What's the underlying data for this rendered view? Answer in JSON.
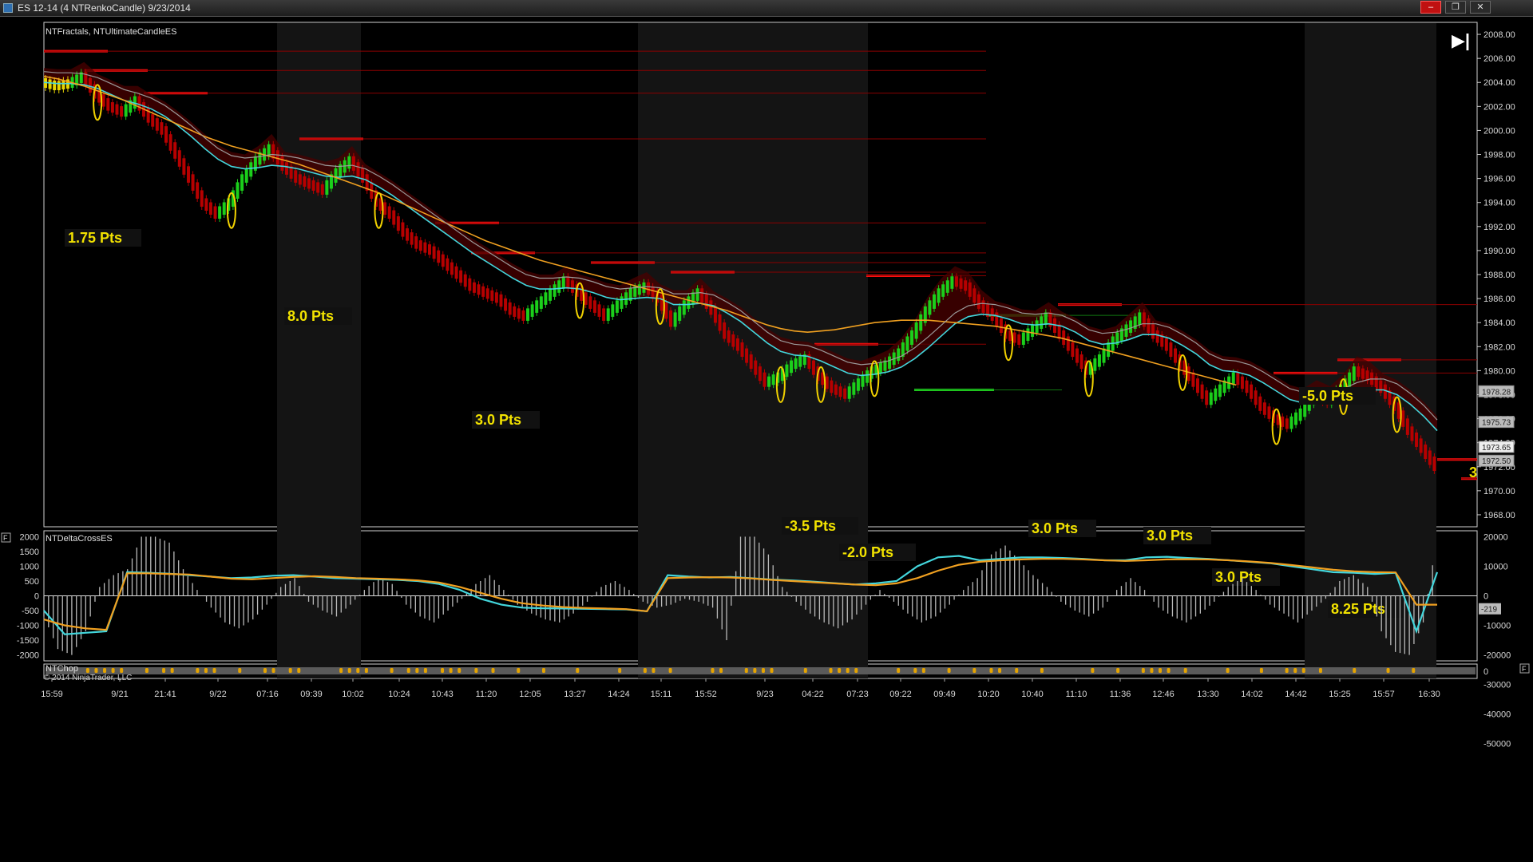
{
  "window": {
    "title": "ES 12-14 (4 NTRenkoCandle)  9/23/2014",
    "minimize_label": "–",
    "restore_label": "❐",
    "close_label": "✕"
  },
  "price_panel": {
    "indicator_label": "NTFractals, NTUltimateCandleES",
    "play_icon_label": "▶|",
    "partial_label": "3"
  },
  "delta_panel": {
    "indicator_label": "NTDeltaCrossES",
    "panel_button": "F"
  },
  "chop_panel": {
    "indicator_label": "NTChop",
    "copyright": "© 2014 NinjaTrader, LLC",
    "axis_label": "0",
    "panel_button": "F"
  },
  "colors": {
    "background": "#000000",
    "session_shade": "#141414",
    "up_bar": "#1bcf1b",
    "down_bar": "#b70000",
    "neutral_bar": "#e7d400",
    "fast_ma": "#43d6dc",
    "slow_ma": "#f0a020",
    "gray_ma": "#9a9a9a",
    "resistance": "#ff1010",
    "support": "#22dd22",
    "annotation": "#f2e200",
    "histogram": "#b9b9b9",
    "chop_dot": "#e5a400"
  },
  "chart_data": [
    {
      "type": "line",
      "title": "",
      "ylim": [
        1967,
        2009
      ],
      "y_ticks": [
        "2008.00",
        "2006.00",
        "2004.00",
        "2002.00",
        "2000.00",
        "1998.00",
        "1996.00",
        "1994.00",
        "1992.00",
        "1990.00",
        "1988.00",
        "1986.00",
        "1984.00",
        "1982.00",
        "1980.00",
        "1978.00",
        "1976.00",
        "1974.00",
        "1972.00",
        "1970.00",
        "1968.00"
      ],
      "x_labels": [
        "15:59",
        "9/21",
        "21:41",
        "9/22",
        "07:16",
        "09:39",
        "10:02",
        "10:24",
        "10:43",
        "11:20",
        "12:05",
        "13:27",
        "14:24",
        "15:11",
        "15:52",
        "9/23",
        "04:22",
        "07:23",
        "09:22",
        "09:49",
        "10:20",
        "10:40",
        "11:10",
        "11:36",
        "12:46",
        "13:30",
        "14:02",
        "14:42",
        "15:25",
        "15:57",
        "16:30"
      ],
      "price_badges": [
        "1978.28",
        "1975.73",
        "1973.65",
        "1972.50"
      ],
      "series": [
        {
          "name": "",
          "values": [
            2004.0,
            2003.7,
            2003.9,
            2004.5,
            2003.0,
            2002.0,
            2001.5,
            2002.5,
            2001.0,
            2000.0,
            1998.0,
            1996.0,
            1994.0,
            1993.0,
            1994.0,
            1996.0,
            1997.5,
            1998.5,
            1997.0,
            1996.0,
            1995.5,
            1995.0,
            1996.5,
            1997.5,
            1996.0,
            1994.0,
            1993.0,
            1991.5,
            1990.5,
            1990.0,
            1989.0,
            1988.0,
            1987.0,
            1986.5,
            1986.0,
            1985.0,
            1984.5,
            1985.5,
            1986.5,
            1987.5,
            1986.5,
            1985.5,
            1984.5,
            1985.5,
            1986.5,
            1987.0,
            1986.0,
            1984.0,
            1985.5,
            1986.5,
            1985.0,
            1983.0,
            1982.0,
            1980.5,
            1979.0,
            1979.5,
            1980.5,
            1981.0,
            1979.5,
            1978.5,
            1978.0,
            1979.0,
            1980.0,
            1980.5,
            1981.5,
            1983.0,
            1985.0,
            1986.5,
            1987.5,
            1987.0,
            1985.5,
            1984.5,
            1983.0,
            1982.5,
            1983.5,
            1984.5,
            1983.0,
            1981.5,
            1980.0,
            1981.0,
            1982.5,
            1983.5,
            1984.5,
            1983.0,
            1982.0,
            1980.5,
            1979.0,
            1977.5,
            1978.5,
            1979.5,
            1978.5,
            1977.0,
            1976.0,
            1975.5,
            1976.5,
            1978.0,
            1977.5,
            1978.5,
            1980.0,
            1979.5,
            1978.5,
            1977.0,
            1975.0,
            1973.5,
            1972.0
          ]
        },
        {
          "name": "",
          "values": [
            2004.0,
            2003.9,
            2003.9,
            2003.8,
            2003.5,
            2003.0,
            2002.5,
            2002.2,
            2001.8,
            2001.2,
            2000.4,
            1999.5,
            1998.5,
            1997.6,
            1997.0,
            1996.8,
            1996.9,
            1997.1,
            1997.0,
            1996.8,
            1996.5,
            1996.2,
            1996.1,
            1996.2,
            1995.9,
            1995.3,
            1994.6,
            1993.8,
            1993.0,
            1992.2,
            1991.4,
            1990.6,
            1989.8,
            1989.1,
            1988.4,
            1987.7,
            1987.1,
            1986.8,
            1986.8,
            1986.9,
            1986.8,
            1986.5,
            1986.1,
            1985.9,
            1986.0,
            1986.1,
            1986.0,
            1985.5,
            1985.5,
            1985.6,
            1985.4,
            1984.8,
            1984.1,
            1983.2,
            1982.3,
            1981.6,
            1981.3,
            1981.2,
            1980.8,
            1980.3,
            1979.8,
            1979.6,
            1979.7,
            1979.9,
            1980.3,
            1981.0,
            1981.9,
            1982.9,
            1983.9,
            1984.5,
            1984.7,
            1984.6,
            1984.3,
            1983.9,
            1983.8,
            1983.9,
            1983.7,
            1983.2,
            1982.5,
            1982.2,
            1982.3,
            1982.6,
            1983.0,
            1983.0,
            1982.7,
            1982.1,
            1981.4,
            1980.5,
            1980.0,
            1979.9,
            1979.6,
            1979.0,
            1978.3,
            1977.6,
            1977.3,
            1977.4,
            1977.4,
            1977.6,
            1978.1,
            1978.4,
            1978.4,
            1978.0,
            1977.2,
            1976.2,
            1975.0
          ]
        },
        {
          "name": "",
          "values": [
            2004.5,
            2004.3,
            2004.0,
            2003.7,
            2003.3,
            2002.9,
            2002.5,
            2002.0,
            2001.5,
            2001.0,
            2000.5,
            2000.0,
            1999.5,
            1999.1,
            1998.7,
            1998.4,
            1998.1,
            1997.8,
            1997.5,
            1997.2,
            1996.8,
            1996.4,
            1996.0,
            1995.6,
            1995.2,
            1994.8,
            1994.3,
            1993.8,
            1993.3,
            1992.8,
            1992.3,
            1991.8,
            1991.3,
            1990.8,
            1990.4,
            1990.0,
            1989.6,
            1989.2,
            1988.9,
            1988.6,
            1988.3,
            1988.0,
            1987.7,
            1987.4,
            1987.1,
            1986.8,
            1986.5,
            1986.2,
            1985.9,
            1985.6,
            1985.3,
            1985.0,
            1984.6,
            1984.2,
            1983.8,
            1983.5,
            1983.3,
            1983.2,
            1983.3,
            1983.4,
            1983.6,
            1983.8,
            1984.0,
            1984.1,
            1984.2,
            1984.2,
            1984.2,
            1984.1,
            1984.0,
            1983.9,
            1983.8,
            1983.7,
            1983.5,
            1983.3,
            1983.1,
            1982.9,
            1982.7,
            1982.4,
            1982.1,
            1981.8,
            1981.5,
            1981.2,
            1980.9,
            1980.6,
            1980.3,
            1980.0,
            1979.7,
            1979.4,
            1979.1,
            1978.8
          ]
        }
      ],
      "resistance_levels": [
        2006.6,
        2005.0,
        2003.1,
        1999.3,
        1992.3,
        1989.8,
        1989.0,
        1988.2,
        1987.9,
        1985.5,
        1982.2,
        1980.9,
        1979.8,
        1972.6,
        1971.0
      ],
      "support_levels": [
        1984.6,
        1978.4
      ],
      "trade_annotations": [
        "1.75 Pts",
        "8.0 Pts",
        "3.0 Pts",
        "-3.5 Pts",
        "-2.0 Pts",
        "3.0 Pts",
        "3.0 Pts",
        "3.0 Pts",
        "-5.0 Pts",
        "8.25 Pts"
      ]
    },
    {
      "type": "bar",
      "title": "",
      "left_ticks": [
        "2000",
        "1500",
        "1000",
        "500",
        "0",
        "-500",
        "-1000",
        "-1500",
        "-2000"
      ],
      "right_ticks": [
        "20000",
        "10000",
        "0",
        "-10000",
        "-20000",
        "-30000",
        "-40000",
        "-50000"
      ],
      "ylim": [
        -2200,
        2200
      ],
      "current_badge": "-219",
      "histogram": [
        -700,
        -1800,
        -2000,
        -1200,
        300,
        700,
        900,
        2000,
        2000,
        1800,
        900,
        200,
        -400,
        -900,
        -1100,
        -800,
        -300,
        300,
        600,
        -200,
        -500,
        -700,
        -300,
        200,
        600,
        400,
        -300,
        -700,
        -900,
        -500,
        -100,
        400,
        700,
        200,
        -300,
        -600,
        -800,
        -900,
        -600,
        -200,
        300,
        500,
        200,
        -200,
        -400,
        -300,
        -100,
        -200,
        -400,
        -1500,
        2000,
        2000,
        1400,
        300,
        -200,
        -600,
        -900,
        -1100,
        -800,
        -300,
        200,
        -200,
        -600,
        -900,
        -700,
        -300,
        200,
        600,
        1400,
        1700,
        1200,
        700,
        300,
        -200,
        -500,
        -700,
        -400,
        200,
        600,
        200,
        -400,
        -700,
        -900,
        -600,
        -200,
        300,
        600,
        200,
        -300,
        -600,
        -900,
        -500,
        -100,
        500,
        700,
        300,
        -1200,
        -1900,
        -2000,
        -900,
        2000
      ],
      "series": [
        {
          "name": "",
          "values": [
            -500,
            -1300,
            -1250,
            -1200,
            800,
            780,
            750,
            700,
            650,
            600,
            620,
            680,
            700,
            650,
            600,
            580,
            560,
            540,
            500,
            400,
            200,
            -100,
            -300,
            -400,
            -420,
            -430,
            -440,
            -450,
            -460,
            -520,
            700,
            650,
            620,
            640,
            600,
            550,
            520,
            480,
            430,
            380,
            420,
            500,
            1000,
            1300,
            1350,
            1200,
            1250,
            1300,
            1300,
            1280,
            1250,
            1200,
            1200,
            1300,
            1320,
            1280,
            1250,
            1200,
            1150,
            1100,
            1000,
            900,
            800,
            780,
            740,
            780,
            -1200,
            800
          ]
        },
        {
          "name": "",
          "values": [
            -800,
            -1000,
            -1100,
            -1150,
            760,
            760,
            740,
            720,
            650,
            580,
            560,
            600,
            640,
            660,
            640,
            600,
            580,
            560,
            520,
            450,
            300,
            100,
            -100,
            -250,
            -330,
            -380,
            -410,
            -430,
            -450,
            -520,
            600,
            620,
            630,
            620,
            590,
            540,
            500,
            460,
            420,
            380,
            360,
            420,
            600,
            850,
            1050,
            1150,
            1200,
            1230,
            1250,
            1250,
            1230,
            1200,
            1180,
            1200,
            1230,
            1240,
            1230,
            1200,
            1160,
            1110,
            1040,
            960,
            880,
            830,
            800,
            790,
            -300,
            -300
          ]
        }
      ]
    },
    {
      "type": "scatter",
      "title": "",
      "chop_dots": [
        5,
        6,
        7,
        8,
        9,
        12,
        14,
        15,
        18,
        19,
        20,
        23,
        26,
        27,
        29,
        30,
        35,
        36,
        37,
        38,
        41,
        43,
        44,
        45,
        47,
        48,
        49,
        51,
        53,
        56,
        59,
        63,
        68,
        71,
        72,
        74,
        79,
        80,
        83,
        84,
        85,
        86,
        90,
        93,
        94,
        95,
        96,
        101,
        103,
        104,
        107,
        110,
        112,
        113,
        115,
        118,
        124,
        127,
        130,
        131,
        132,
        133,
        135,
        140,
        144,
        147,
        148,
        149,
        151,
        155,
        159,
        162
      ]
    }
  ]
}
